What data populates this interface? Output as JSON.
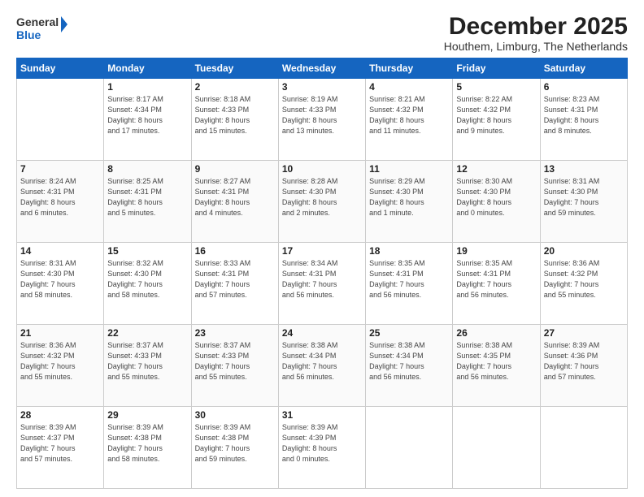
{
  "logo": {
    "line1": "General",
    "line2": "Blue"
  },
  "title": "December 2025",
  "subtitle": "Houthem, Limburg, The Netherlands",
  "weekdays": [
    "Sunday",
    "Monday",
    "Tuesday",
    "Wednesday",
    "Thursday",
    "Friday",
    "Saturday"
  ],
  "weeks": [
    [
      {
        "day": "",
        "info": ""
      },
      {
        "day": "1",
        "info": "Sunrise: 8:17 AM\nSunset: 4:34 PM\nDaylight: 8 hours\nand 17 minutes."
      },
      {
        "day": "2",
        "info": "Sunrise: 8:18 AM\nSunset: 4:33 PM\nDaylight: 8 hours\nand 15 minutes."
      },
      {
        "day": "3",
        "info": "Sunrise: 8:19 AM\nSunset: 4:33 PM\nDaylight: 8 hours\nand 13 minutes."
      },
      {
        "day": "4",
        "info": "Sunrise: 8:21 AM\nSunset: 4:32 PM\nDaylight: 8 hours\nand 11 minutes."
      },
      {
        "day": "5",
        "info": "Sunrise: 8:22 AM\nSunset: 4:32 PM\nDaylight: 8 hours\nand 9 minutes."
      },
      {
        "day": "6",
        "info": "Sunrise: 8:23 AM\nSunset: 4:31 PM\nDaylight: 8 hours\nand 8 minutes."
      }
    ],
    [
      {
        "day": "7",
        "info": "Sunrise: 8:24 AM\nSunset: 4:31 PM\nDaylight: 8 hours\nand 6 minutes."
      },
      {
        "day": "8",
        "info": "Sunrise: 8:25 AM\nSunset: 4:31 PM\nDaylight: 8 hours\nand 5 minutes."
      },
      {
        "day": "9",
        "info": "Sunrise: 8:27 AM\nSunset: 4:31 PM\nDaylight: 8 hours\nand 4 minutes."
      },
      {
        "day": "10",
        "info": "Sunrise: 8:28 AM\nSunset: 4:30 PM\nDaylight: 8 hours\nand 2 minutes."
      },
      {
        "day": "11",
        "info": "Sunrise: 8:29 AM\nSunset: 4:30 PM\nDaylight: 8 hours\nand 1 minute."
      },
      {
        "day": "12",
        "info": "Sunrise: 8:30 AM\nSunset: 4:30 PM\nDaylight: 8 hours\nand 0 minutes."
      },
      {
        "day": "13",
        "info": "Sunrise: 8:31 AM\nSunset: 4:30 PM\nDaylight: 7 hours\nand 59 minutes."
      }
    ],
    [
      {
        "day": "14",
        "info": "Sunrise: 8:31 AM\nSunset: 4:30 PM\nDaylight: 7 hours\nand 58 minutes."
      },
      {
        "day": "15",
        "info": "Sunrise: 8:32 AM\nSunset: 4:30 PM\nDaylight: 7 hours\nand 58 minutes."
      },
      {
        "day": "16",
        "info": "Sunrise: 8:33 AM\nSunset: 4:31 PM\nDaylight: 7 hours\nand 57 minutes."
      },
      {
        "day": "17",
        "info": "Sunrise: 8:34 AM\nSunset: 4:31 PM\nDaylight: 7 hours\nand 56 minutes."
      },
      {
        "day": "18",
        "info": "Sunrise: 8:35 AM\nSunset: 4:31 PM\nDaylight: 7 hours\nand 56 minutes."
      },
      {
        "day": "19",
        "info": "Sunrise: 8:35 AM\nSunset: 4:31 PM\nDaylight: 7 hours\nand 56 minutes."
      },
      {
        "day": "20",
        "info": "Sunrise: 8:36 AM\nSunset: 4:32 PM\nDaylight: 7 hours\nand 55 minutes."
      }
    ],
    [
      {
        "day": "21",
        "info": "Sunrise: 8:36 AM\nSunset: 4:32 PM\nDaylight: 7 hours\nand 55 minutes."
      },
      {
        "day": "22",
        "info": "Sunrise: 8:37 AM\nSunset: 4:33 PM\nDaylight: 7 hours\nand 55 minutes."
      },
      {
        "day": "23",
        "info": "Sunrise: 8:37 AM\nSunset: 4:33 PM\nDaylight: 7 hours\nand 55 minutes."
      },
      {
        "day": "24",
        "info": "Sunrise: 8:38 AM\nSunset: 4:34 PM\nDaylight: 7 hours\nand 56 minutes."
      },
      {
        "day": "25",
        "info": "Sunrise: 8:38 AM\nSunset: 4:34 PM\nDaylight: 7 hours\nand 56 minutes."
      },
      {
        "day": "26",
        "info": "Sunrise: 8:38 AM\nSunset: 4:35 PM\nDaylight: 7 hours\nand 56 minutes."
      },
      {
        "day": "27",
        "info": "Sunrise: 8:39 AM\nSunset: 4:36 PM\nDaylight: 7 hours\nand 57 minutes."
      }
    ],
    [
      {
        "day": "28",
        "info": "Sunrise: 8:39 AM\nSunset: 4:37 PM\nDaylight: 7 hours\nand 57 minutes."
      },
      {
        "day": "29",
        "info": "Sunrise: 8:39 AM\nSunset: 4:38 PM\nDaylight: 7 hours\nand 58 minutes."
      },
      {
        "day": "30",
        "info": "Sunrise: 8:39 AM\nSunset: 4:38 PM\nDaylight: 7 hours\nand 59 minutes."
      },
      {
        "day": "31",
        "info": "Sunrise: 8:39 AM\nSunset: 4:39 PM\nDaylight: 8 hours\nand 0 minutes."
      },
      {
        "day": "",
        "info": ""
      },
      {
        "day": "",
        "info": ""
      },
      {
        "day": "",
        "info": ""
      }
    ]
  ]
}
